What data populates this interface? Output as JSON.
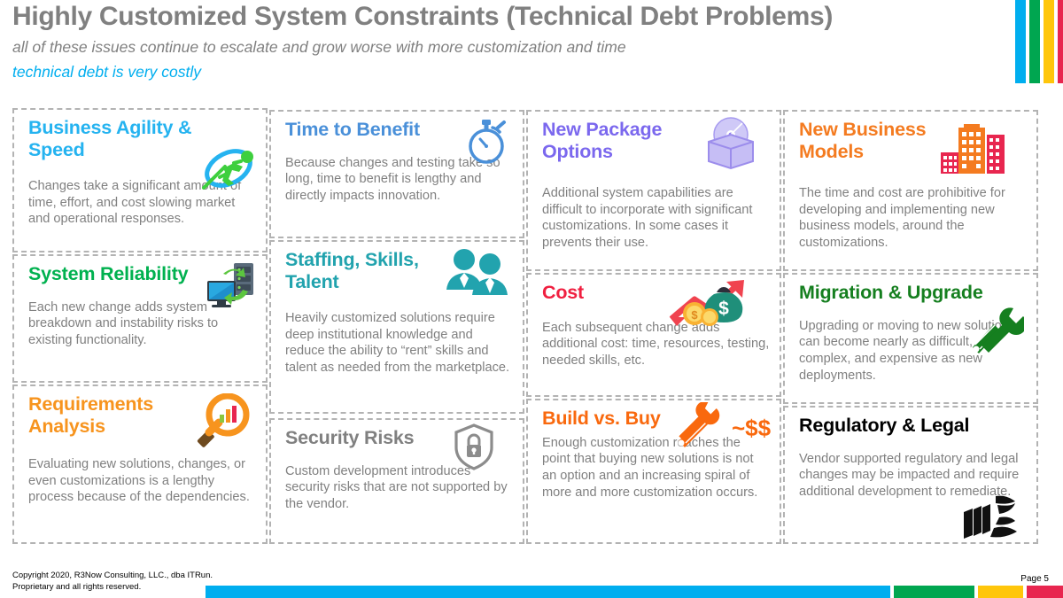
{
  "header": {
    "title": "Highly Customized System Constraints (Technical Debt Problems)",
    "subtitle_1": "all of these issues continue to escalate and grow worse with more customization and time",
    "subtitle_2": "technical debt is very costly",
    "accent_bars": [
      "#00AEEF",
      "#00A650",
      "#FFC60B",
      "#E8264F"
    ]
  },
  "cards": {
    "business_agility": {
      "title": "Business Agility & Speed",
      "body": "Changes take a significant amount of time, effort, and cost slowing market and operational responses.",
      "color": "#25B3F0",
      "icon": "runner-orbit-icon"
    },
    "system_reliability": {
      "title": "System Reliability",
      "body": "Each new change adds system breakdown and instability risks to existing functionality.",
      "color": "#00B14F",
      "icon": "server-sync-icon"
    },
    "requirements_analysis": {
      "title": "Requirements Analysis",
      "body": "Evaluating new solutions, changes, or even customizations is a lengthy process because of the dependencies.",
      "color": "#F7941E",
      "icon": "magnifier-chart-icon"
    },
    "time_to_benefit": {
      "title": "Time to Benefit",
      "body": "Because changes and testing take so long, time to benefit is lengthy and directly impacts innovation.",
      "color": "#4A90D9",
      "icon": "stopwatch-icon"
    },
    "staffing_skills": {
      "title": "Staffing, Skills, Talent",
      "body": "Heavily customized solutions require deep institutional knowledge and reduce the ability to “rent” skills and talent as needed from the marketplace.",
      "color": "#22A3AE",
      "icon": "two-people-icon"
    },
    "security_risks": {
      "title": "Security Risks",
      "body": "Custom development introduces security risks that are not supported by the vendor.",
      "color": "#808080",
      "icon": "shield-lock-icon"
    },
    "new_package_options": {
      "title": "New Package Options",
      "body": "Additional system capabilities are difficult to incorporate with significant customizations. In some cases it prevents their use.",
      "color": "#7B68EE",
      "icon": "package-disc-icon"
    },
    "cost": {
      "title": "Cost",
      "body": "Each subsequent change adds additional cost: time, resources, testing, needed skills, etc.",
      "color": "#F01F40",
      "icon": "money-bag-rising-arrow-icon"
    },
    "build_vs_buy": {
      "title": "Build vs. Buy",
      "body": "Enough customization reaches the point that buying new solutions is not an option and an increasing spiral of more and more customization occurs.",
      "color": "#F9690E",
      "icon": "tools-dollars-icon",
      "icon_label": "~$$"
    },
    "new_business_models": {
      "title": "New Business Models",
      "body": "The time and cost are prohibitive for developing and implementing new business models, around the customizations.",
      "color": "#F47B20",
      "icon": "city-buildings-icon"
    },
    "migration_upgrade": {
      "title": "Migration & Upgrade",
      "body": "Upgrading or moving to new solutions can become nearly as difficult, complex, and expensive as new deployments.",
      "color": "#157F1F",
      "icon": "screwdriver-wrench-icon"
    },
    "regulatory_legal": {
      "title": "Regulatory & Legal",
      "body": "Vendor supported regulatory and legal changes may be impacted and require additional development to remediate.",
      "color": "#000000",
      "icon": "law-books-scales-icon"
    }
  },
  "footer": {
    "copyright_line_1": "Copyright 2020, R3Now Consulting, LLC., dba ITRun.",
    "copyright_line_2": "Proprietary and all rights reserved.",
    "page_label": "Page 5",
    "bars": [
      "#00AEEF",
      "#00A650",
      "#FFC60B",
      "#E8264F"
    ]
  }
}
